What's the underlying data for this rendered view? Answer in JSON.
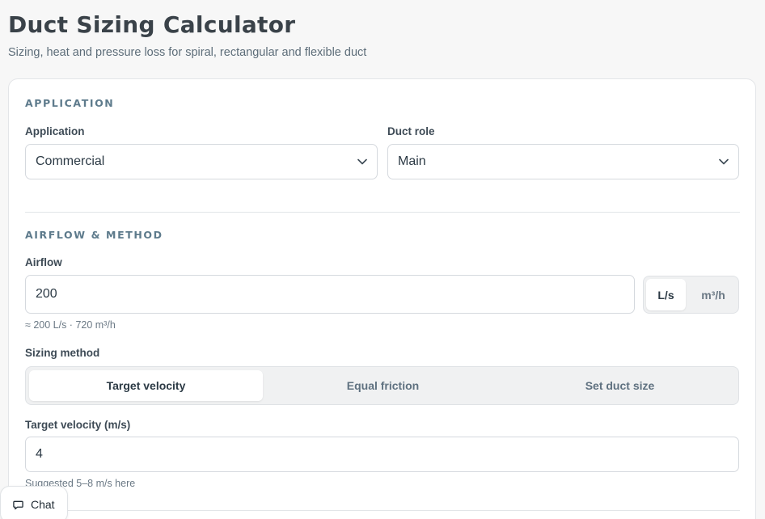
{
  "header": {
    "title": "Duct Sizing Calculator",
    "subtitle": "Sizing, heat and pressure loss for spiral, rectangular and flexible duct"
  },
  "application_section": {
    "heading": "APPLICATION",
    "application": {
      "label": "Application",
      "value": "Commercial"
    },
    "duct_role": {
      "label": "Duct role",
      "value": "Main"
    }
  },
  "airflow_section": {
    "heading": "AIRFLOW & METHOD",
    "airflow": {
      "label": "Airflow",
      "value": "200",
      "units": [
        "L/s",
        "m³/h"
      ],
      "selected_unit": "L/s",
      "hint": "≈ 200 L/s · 720 m³/h"
    },
    "sizing_method": {
      "label": "Sizing method",
      "options": [
        "Target velocity",
        "Equal friction",
        "Set duct size"
      ],
      "selected": "Target velocity"
    },
    "target_velocity": {
      "label": "Target velocity (m/s)",
      "value": "4",
      "hint": "Suggested 5–8 m/s here"
    }
  },
  "chat": {
    "label": "Chat"
  },
  "icons": {
    "select_chevron": "chevron-down-icon",
    "chat": "chat-bubble-icon"
  }
}
